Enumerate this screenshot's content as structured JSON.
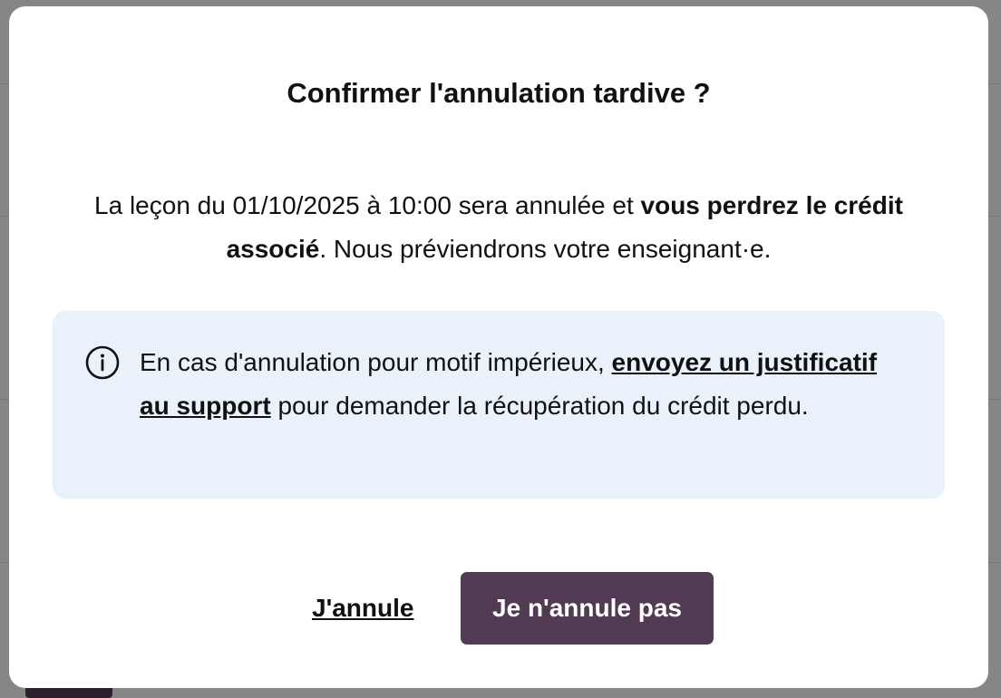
{
  "dialog": {
    "title": "Confirmer l'annulation tardive ?",
    "message_part1": "La leçon du 01/10/2025 à 10:00 sera annulée et ",
    "message_bold": "vous perdrez le crédit associé",
    "message_part2": ". Nous préviendrons votre enseignant·e.",
    "info": {
      "icon": "info-icon",
      "text_before": "En cas d'annulation pour motif impérieux, ",
      "link_label": "envoyez un justificatif au support",
      "text_after": " pour demander la récupération du crédit perdu."
    },
    "cancel_label": "J'annule",
    "keep_label": "Je n'annule pas"
  },
  "colors": {
    "primary_button": "#523a54",
    "info_background": "#e9f2fb"
  }
}
